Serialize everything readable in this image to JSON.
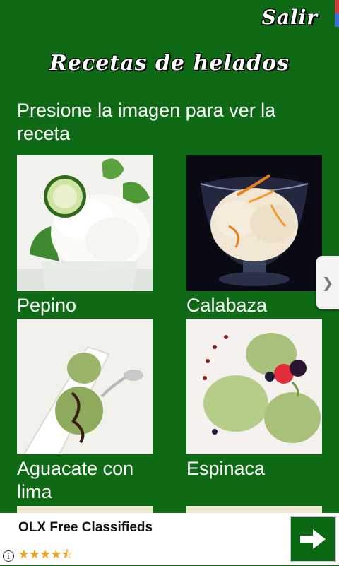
{
  "header": {
    "exit_label": "Salir",
    "title": "Recetas de helados"
  },
  "instructions": "Presione la imagen para ver la receta",
  "recipes": [
    {
      "label": "Pepino"
    },
    {
      "label": "Calabaza"
    },
    {
      "label": "Aguacate con lima"
    },
    {
      "label": "Espinaca"
    }
  ],
  "ad": {
    "title": "OLX Free Classifieds",
    "rating_stars": "★★★★⯪",
    "info_glyph": "i",
    "cta_icon": "arrow-right-icon"
  },
  "side_handle": {
    "glyph": "❯"
  },
  "colors": {
    "background": "#0f6a15",
    "ad_cta": "#0b6812",
    "star": "#f0a11b"
  }
}
